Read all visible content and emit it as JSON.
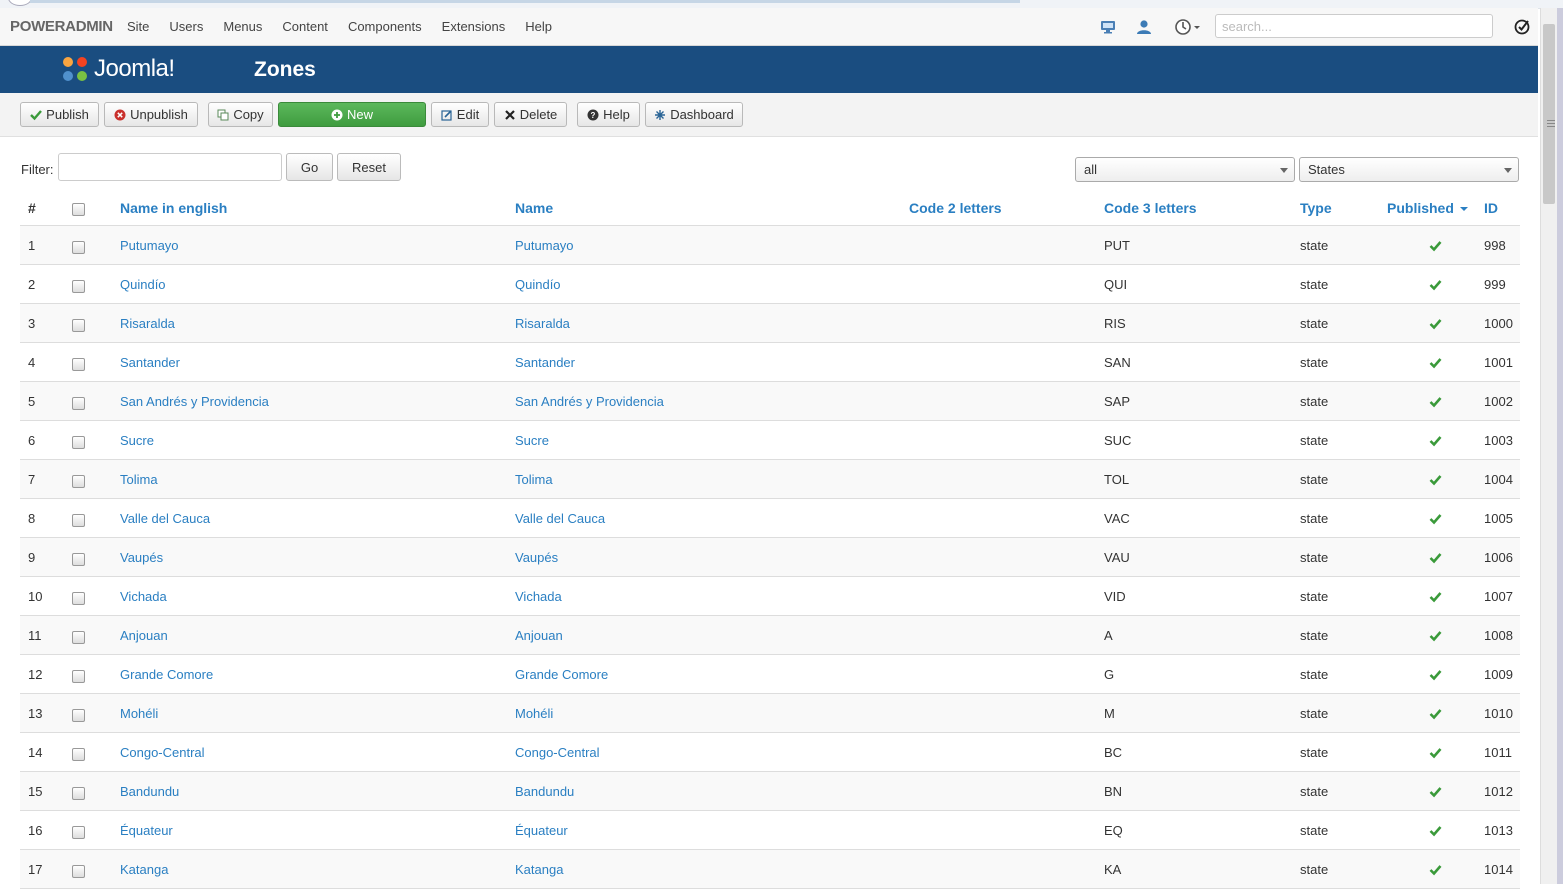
{
  "navbar": {
    "brand": "POWERADMIN",
    "menu": [
      "Site",
      "Users",
      "Menus",
      "Content",
      "Components",
      "Extensions",
      "Help"
    ],
    "search_placeholder": "search..."
  },
  "header": {
    "logo_text": "Joomla!",
    "title": "Zones"
  },
  "toolbar": {
    "publish": "Publish",
    "unpublish": "Unpublish",
    "copy": "Copy",
    "new": "New",
    "edit": "Edit",
    "delete": "Delete",
    "help": "Help",
    "dashboard": "Dashboard"
  },
  "filter": {
    "label": "Filter:",
    "value": "",
    "go": "Go",
    "reset": "Reset",
    "select_published": "all",
    "select_type": "States"
  },
  "table": {
    "headers": {
      "num": "#",
      "name_en": "Name in english",
      "name": "Name",
      "code2": "Code 2 letters",
      "code3": "Code 3 letters",
      "type": "Type",
      "published": "Published",
      "id": "ID"
    },
    "rows": [
      {
        "num": "1",
        "name_en": "Putumayo",
        "name": "Putumayo",
        "code2": "",
        "code3": "PUT",
        "type": "state",
        "id": "998"
      },
      {
        "num": "2",
        "name_en": "Quindío",
        "name": "Quindío",
        "code2": "",
        "code3": "QUI",
        "type": "state",
        "id": "999"
      },
      {
        "num": "3",
        "name_en": "Risaralda",
        "name": "Risaralda",
        "code2": "",
        "code3": "RIS",
        "type": "state",
        "id": "1000"
      },
      {
        "num": "4",
        "name_en": "Santander",
        "name": "Santander",
        "code2": "",
        "code3": "SAN",
        "type": "state",
        "id": "1001"
      },
      {
        "num": "5",
        "name_en": "San Andrés y Providencia",
        "name": "San Andrés y Providencia",
        "code2": "",
        "code3": "SAP",
        "type": "state",
        "id": "1002"
      },
      {
        "num": "6",
        "name_en": "Sucre",
        "name": "Sucre",
        "code2": "",
        "code3": "SUC",
        "type": "state",
        "id": "1003"
      },
      {
        "num": "7",
        "name_en": "Tolima",
        "name": "Tolima",
        "code2": "",
        "code3": "TOL",
        "type": "state",
        "id": "1004"
      },
      {
        "num": "8",
        "name_en": "Valle del Cauca",
        "name": "Valle del Cauca",
        "code2": "",
        "code3": "VAC",
        "type": "state",
        "id": "1005"
      },
      {
        "num": "9",
        "name_en": "Vaupés",
        "name": "Vaupés",
        "code2": "",
        "code3": "VAU",
        "type": "state",
        "id": "1006"
      },
      {
        "num": "10",
        "name_en": "Vichada",
        "name": "Vichada",
        "code2": "",
        "code3": "VID",
        "type": "state",
        "id": "1007"
      },
      {
        "num": "11",
        "name_en": "Anjouan",
        "name": "Anjouan",
        "code2": "",
        "code3": "A",
        "type": "state",
        "id": "1008"
      },
      {
        "num": "12",
        "name_en": "Grande Comore",
        "name": "Grande Comore",
        "code2": "",
        "code3": "G",
        "type": "state",
        "id": "1009"
      },
      {
        "num": "13",
        "name_en": "Mohéli",
        "name": "Mohéli",
        "code2": "",
        "code3": "M",
        "type": "state",
        "id": "1010"
      },
      {
        "num": "14",
        "name_en": "Congo-Central",
        "name": "Congo-Central",
        "code2": "",
        "code3": "BC",
        "type": "state",
        "id": "1011"
      },
      {
        "num": "15",
        "name_en": "Bandundu",
        "name": "Bandundu",
        "code2": "",
        "code3": "BN",
        "type": "state",
        "id": "1012"
      },
      {
        "num": "16",
        "name_en": "Équateur",
        "name": "Équateur",
        "code2": "",
        "code3": "EQ",
        "type": "state",
        "id": "1013"
      },
      {
        "num": "17",
        "name_en": "Katanga",
        "name": "Katanga",
        "code2": "",
        "code3": "KA",
        "type": "state",
        "id": "1014"
      }
    ]
  },
  "colors": {
    "header_bg": "#1a4d80",
    "link": "#2a7fc2",
    "new_button": "#5cb85c",
    "published_check": "#3a9a3a"
  },
  "icons": {
    "published": "check-icon",
    "sort": "caret-down-icon"
  }
}
